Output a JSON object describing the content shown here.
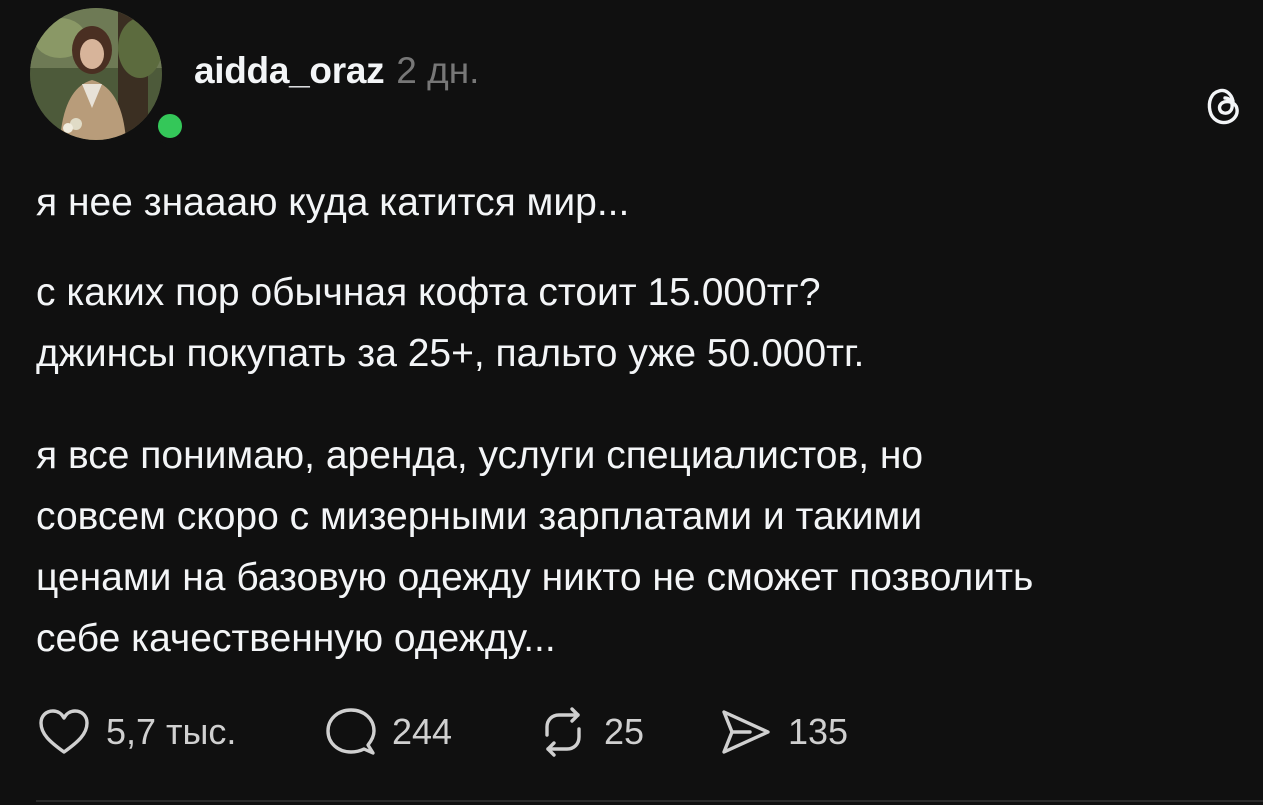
{
  "post": {
    "author": {
      "username": "aidda_oraz",
      "avatar_icon": "profile-photo",
      "online_status_color": "#34c759"
    },
    "time": "2 дн.",
    "app_icon": "threads-logo-icon",
    "paragraphs": [
      [
        "я нее знааaю куда катится мир..."
      ],
      [
        "с каких пор обычная кофта стоит 15.000тг?",
        "джинсы покупать за 25+, пальто уже 50.000тг."
      ],
      [
        "я все понимаю, аренда, услуги специалистов, но",
        "совсем скоро с мизерными зарплатами и такими",
        "ценами на базовую одежду никто не сможет позволить",
        "себе качественную одежду..."
      ]
    ],
    "actions": {
      "like": {
        "icon": "heart-icon",
        "count": "5,7 тыс."
      },
      "comment": {
        "icon": "comment-bubble-icon",
        "count": "244"
      },
      "repost": {
        "icon": "repost-icon",
        "count": "25"
      },
      "share": {
        "icon": "send-icon",
        "count": "135"
      }
    }
  },
  "colors": {
    "background": "#101010",
    "text_primary": "#f3f5f7",
    "text_secondary": "#777777"
  }
}
